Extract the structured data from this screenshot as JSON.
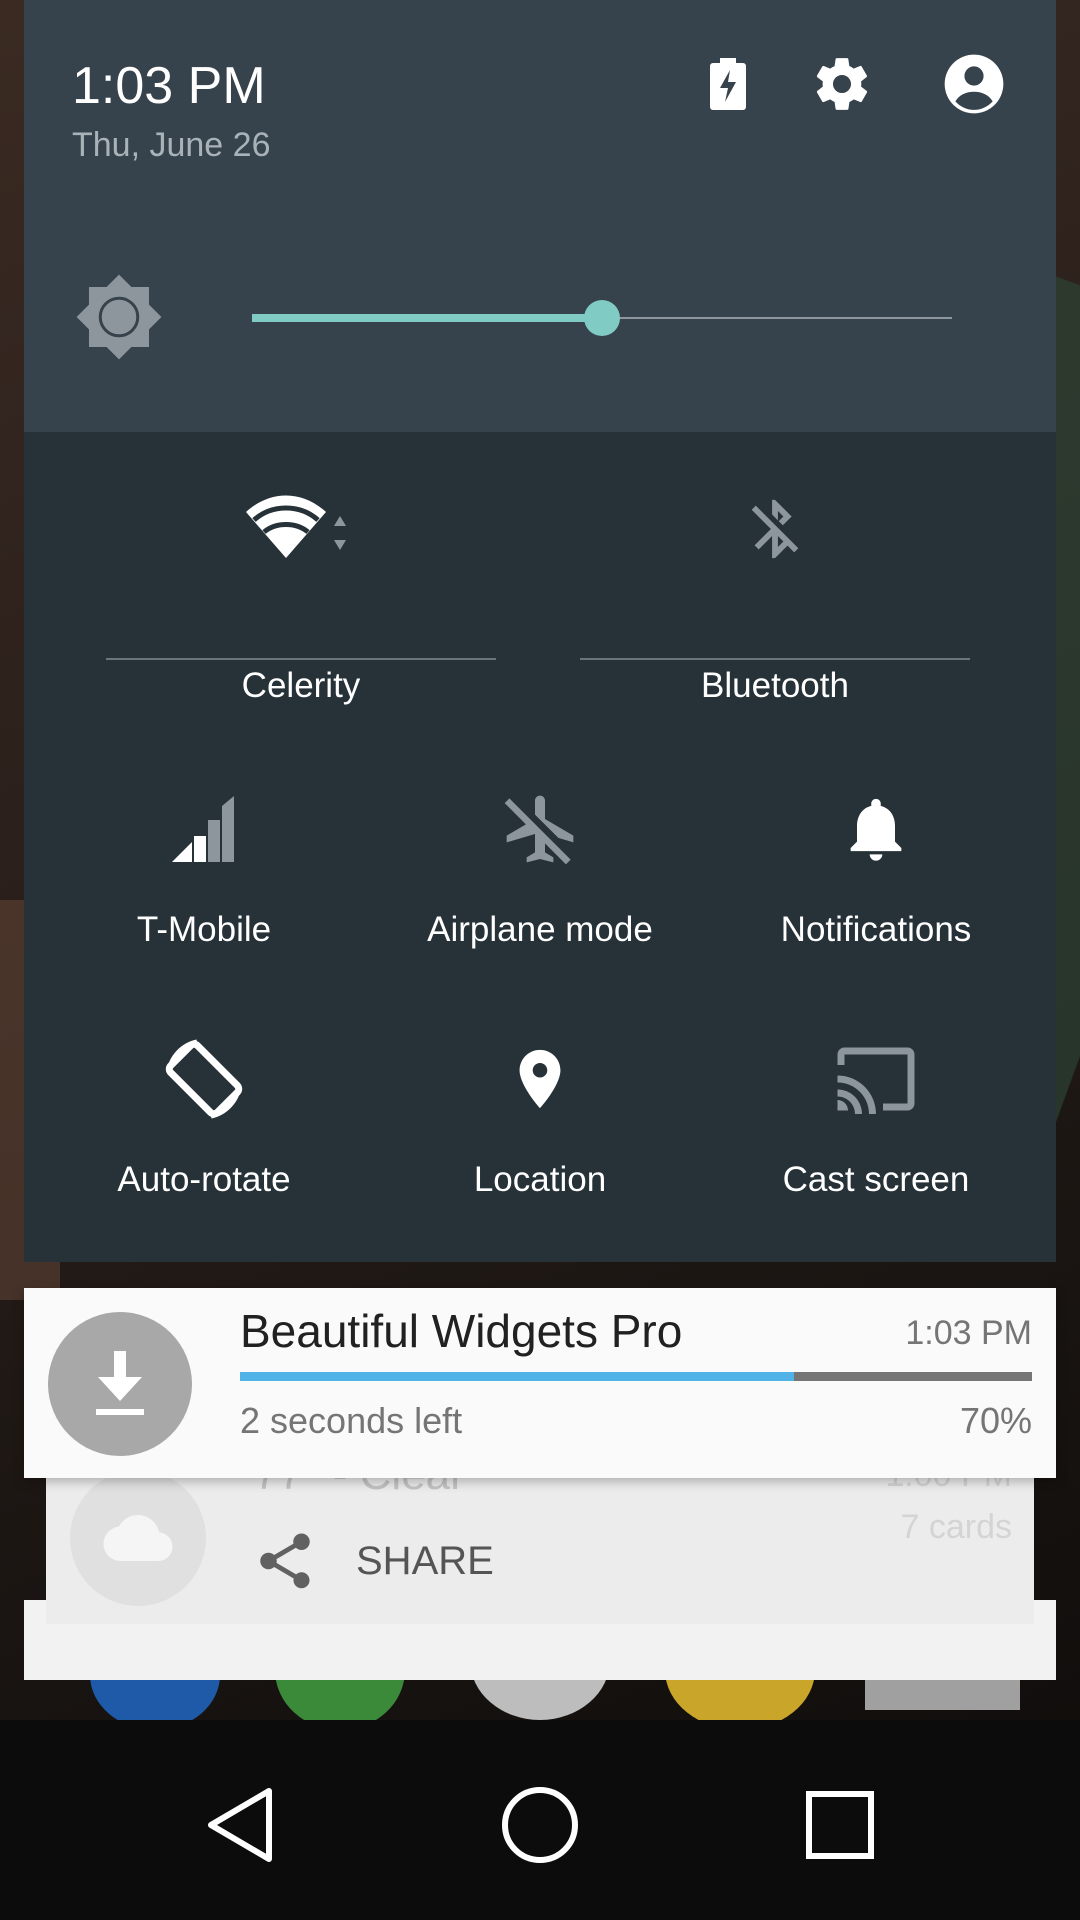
{
  "header": {
    "time": "1:03 PM",
    "date": "Thu, June 26",
    "icons": [
      "battery-charging-icon",
      "gear-icon",
      "account-icon"
    ]
  },
  "brightness": {
    "level": 0.5,
    "icon": "brightness-icon"
  },
  "tiles": {
    "wifi": {
      "label": "Celerity",
      "icon": "wifi-icon"
    },
    "bluetooth": {
      "label": "Bluetooth",
      "icon": "bluetooth-off-icon"
    },
    "cellular": {
      "label": "T-Mobile",
      "icon": "signal-icon"
    },
    "airplane": {
      "label": "Airplane mode",
      "icon": "airplane-off-icon"
    },
    "notifications": {
      "label": "Notifications",
      "icon": "bell-icon"
    },
    "rotate": {
      "label": "Auto-rotate",
      "icon": "rotate-icon"
    },
    "location": {
      "label": "Location",
      "icon": "location-pin-icon"
    },
    "cast": {
      "label": "Cast screen",
      "icon": "cast-icon"
    }
  },
  "notification_download": {
    "title": "Beautiful Widgets Pro",
    "time": "1:03 PM",
    "status": "2 seconds left",
    "percent": "70%",
    "progress": 0.7,
    "icon": "download-icon"
  },
  "notification_weather": {
    "title": "77° - Clear",
    "time": "1:00 PM",
    "subtitle": "7 cards",
    "action_label": "SHARE",
    "icon": "cloud-icon",
    "action_icon": "share-icon"
  },
  "nav": {
    "icons": [
      "back-icon",
      "home-icon",
      "recents-icon"
    ]
  },
  "colors": {
    "accent": "#80cbc4",
    "progress": "#4fb3e8",
    "header_bg": "#37434c",
    "panel_bg": "#263238"
  }
}
